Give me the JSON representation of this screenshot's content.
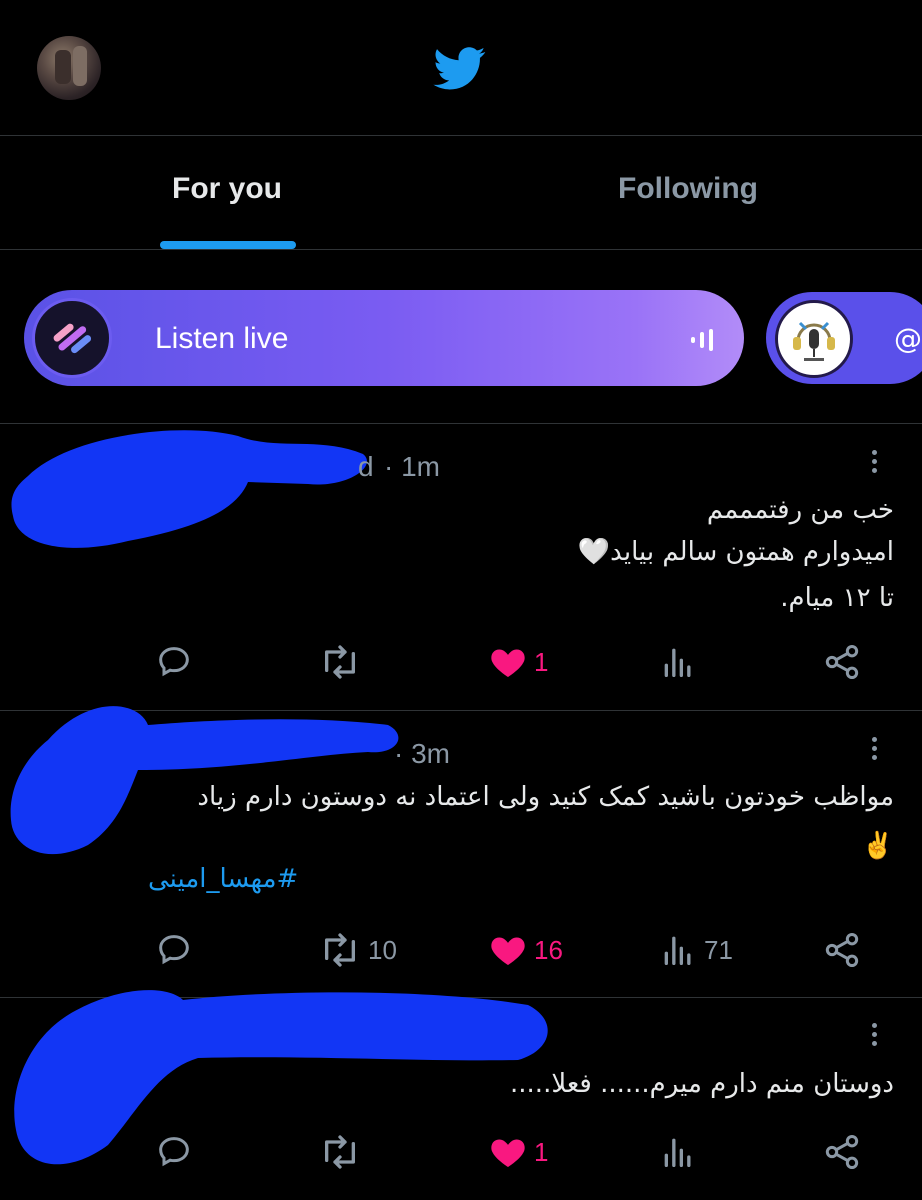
{
  "header": {
    "logo": "twitter-bird-icon",
    "avatar": "user-avatar"
  },
  "tabs": [
    {
      "label": "For you",
      "active": true
    },
    {
      "label": "Following",
      "active": false
    }
  ],
  "spaces": {
    "label": "Listen live",
    "second_prefix": "@"
  },
  "tweets": [
    {
      "time": "· 1m",
      "partial_name": "d",
      "lines": [
        "خب من رفتمممم",
        "امیدوارم همتون سالم بیاید🤍",
        "تا ۱۲ میام."
      ],
      "actions": {
        "replies": "",
        "retweets": "",
        "likes": "1",
        "views": ""
      }
    },
    {
      "time": "· 3m",
      "lines": [
        "مواظب خودتون باشید کمک کنید ولی اعتماد نه دوستون دارم زیاد",
        "✌️"
      ],
      "hashtag": "#مهسا_امینی",
      "actions": {
        "replies": "",
        "retweets": "10",
        "likes": "16",
        "views": "71"
      }
    },
    {
      "time": "",
      "lines": [
        "دوستان منم دارم میرم...... فعلا....."
      ],
      "actions": {
        "replies": "",
        "retweets": "",
        "likes": "1",
        "views": ""
      }
    }
  ],
  "colors": {
    "accent": "#1d9bf0",
    "like": "#f91880",
    "muted": "#8b98a5",
    "redaction": "#1236f5"
  }
}
